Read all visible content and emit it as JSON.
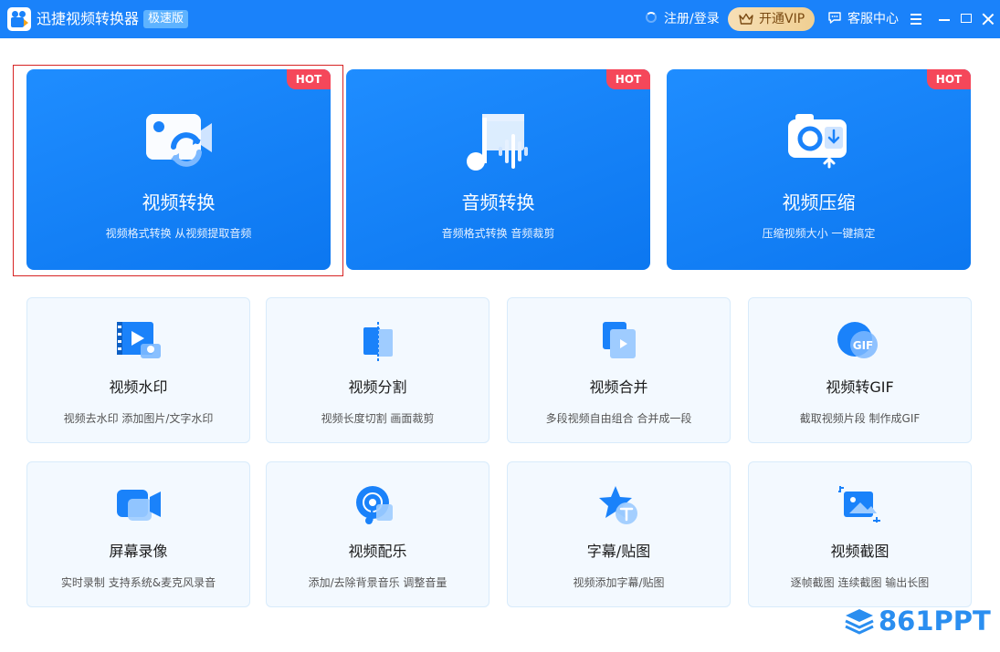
{
  "titlebar": {
    "app_title": "迅捷视频转换器",
    "edition_badge": "极速版",
    "login_link": "注册/登录",
    "vip_button": "开通VIP",
    "service_link": "客服中心"
  },
  "feature_cards": [
    {
      "title": "视频转换",
      "subtitle": "视频格式转换 从视频提取音频",
      "badge": "HOT",
      "icon": "video-convert-icon",
      "selected": true
    },
    {
      "title": "音频转换",
      "subtitle": "音频格式转换 音频裁剪",
      "badge": "HOT",
      "icon": "audio-convert-icon"
    },
    {
      "title": "视频压缩",
      "subtitle": "压缩视频大小 一键搞定",
      "badge": "HOT",
      "icon": "video-compress-icon"
    }
  ],
  "tool_cards": [
    {
      "title": "视频水印",
      "subtitle": "视频去水印 添加图片/文字水印",
      "icon": "watermark-icon"
    },
    {
      "title": "视频分割",
      "subtitle": "视频长度切割 画面裁剪",
      "icon": "split-icon"
    },
    {
      "title": "视频合并",
      "subtitle": "多段视频自由组合 合并成一段",
      "icon": "merge-icon"
    },
    {
      "title": "视频转GIF",
      "subtitle": "截取视频片段 制作成GIF",
      "icon": "gif-icon"
    },
    {
      "title": "屏幕录像",
      "subtitle": "实时录制 支持系统&麦克风录音",
      "icon": "screen-record-icon"
    },
    {
      "title": "视频配乐",
      "subtitle": "添加/去除背景音乐 调整音量",
      "icon": "music-icon"
    },
    {
      "title": "字幕/贴图",
      "subtitle": "视频添加字幕/贴图",
      "icon": "subtitle-icon"
    },
    {
      "title": "视频截图",
      "subtitle": "逐帧截图 连续截图 输出长图",
      "icon": "screenshot-icon"
    }
  ],
  "watermark": {
    "text": "861PPT"
  },
  "colors": {
    "primary": "#1a82fa",
    "hot": "#f5475a",
    "selected_border": "#d72424",
    "vip_gold": "#f0cf92"
  }
}
